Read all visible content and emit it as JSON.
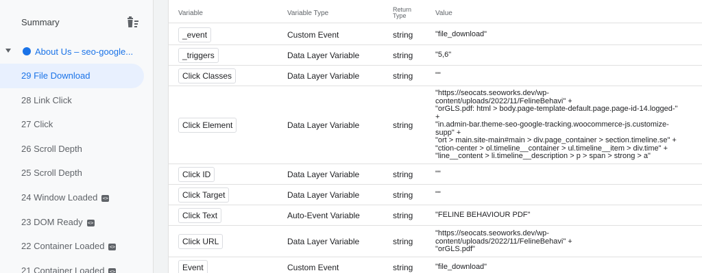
{
  "sidebar": {
    "summary_label": "Summary",
    "page_label": "About Us – seo-google...",
    "events": [
      {
        "label": "29 File Download",
        "active": true,
        "code": false
      },
      {
        "label": "28 Link Click",
        "active": false,
        "code": false
      },
      {
        "label": "27 Click",
        "active": false,
        "code": false
      },
      {
        "label": "26 Scroll Depth",
        "active": false,
        "code": false
      },
      {
        "label": "25 Scroll Depth",
        "active": false,
        "code": false
      },
      {
        "label": "24 Window Loaded",
        "active": false,
        "code": true
      },
      {
        "label": "23 DOM Ready",
        "active": false,
        "code": true
      },
      {
        "label": "22 Container Loaded",
        "active": false,
        "code": true
      },
      {
        "label": "21 Container Loaded",
        "active": false,
        "code": true
      }
    ]
  },
  "table": {
    "headers": {
      "variable": "Variable",
      "type": "Variable Type",
      "return": "Return\nType",
      "value": "Value"
    },
    "rows": [
      {
        "name": "_event",
        "type": "Custom Event",
        "ret": "string",
        "value": "\"file_download\""
      },
      {
        "name": "_triggers",
        "type": "Data Layer Variable",
        "ret": "string",
        "value": "\"5,6\""
      },
      {
        "name": "Click Classes",
        "type": "Data Layer Variable",
        "ret": "string",
        "value": "\"\""
      },
      {
        "name": "Click Element",
        "type": "Data Layer Variable",
        "ret": "string",
        "value": "\"https://seocats.seoworks.dev/wp-\ncontent/uploads/2022/11/FelineBehavi\" +\n\"orGLS.pdf: html > body.page-template-default.page.page-id-14.logged-\"\n+\n\"in.admin-bar.theme-seo-google-tracking.woocommerce-js.customize-\nsupp\" +\n\"ort > main.site-main#main > div.page_container > section.timeline.se\" +\n\"ction-center > ol.timeline__container > ul.timeline__item > div.time\" +\n\"line__content > li.timeline__description > p > span > strong > a\""
      },
      {
        "name": "Click ID",
        "type": "Data Layer Variable",
        "ret": "string",
        "value": "\"\""
      },
      {
        "name": "Click Target",
        "type": "Data Layer Variable",
        "ret": "string",
        "value": "\"\""
      },
      {
        "name": "Click Text",
        "type": "Auto-Event Variable",
        "ret": "string",
        "value": "\"FELINE BEHAVIOUR PDF\""
      },
      {
        "name": "Click URL",
        "type": "Data Layer Variable",
        "ret": "string",
        "value": "\"https://seocats.seoworks.dev/wp-\ncontent/uploads/2022/11/FelineBehavi\" +\n\"orGLS.pdf\""
      },
      {
        "name": "Event",
        "type": "Custom Event",
        "ret": "string",
        "value": "\"file_download\""
      }
    ]
  }
}
